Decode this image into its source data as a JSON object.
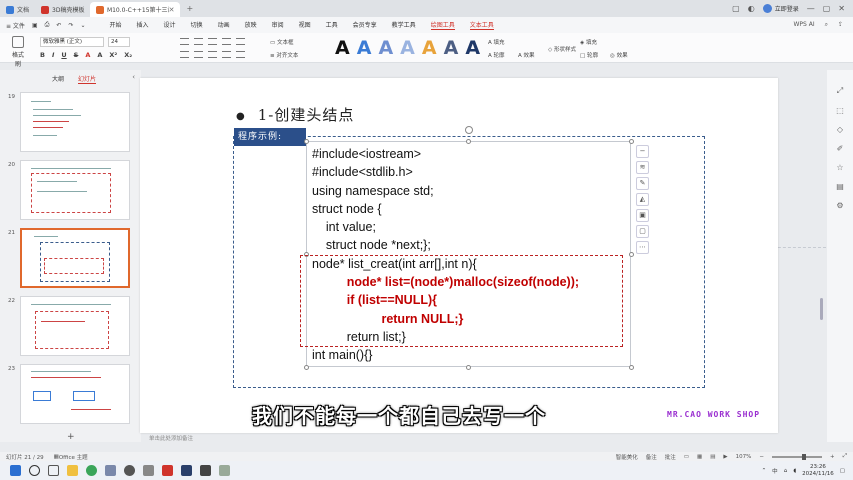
{
  "titlebar": {
    "tabs": [
      {
        "label": "文档",
        "color": "#3a7bd5"
      },
      {
        "label": "3D稿壳模板",
        "color": "#d0342c"
      },
      {
        "label": "M10.0-C++15第十三讲-链表创...",
        "color": "#e0682c",
        "active": true
      }
    ],
    "login_label": "立即登录"
  },
  "menubar": {
    "file_label": "≡ 文件",
    "items": [
      "开始",
      "插入",
      "设计",
      "切换",
      "动画",
      "放映",
      "审阅",
      "视图",
      "工具",
      "会员专享",
      "教学工具",
      "绘图工具",
      "文本工具"
    ],
    "highlight": [
      "绘图工具",
      "文本工具"
    ],
    "right_items": [
      "WPS AI"
    ]
  },
  "ribbon": {
    "paste_label": "格式刷",
    "font_name": "微软雅黑 (正文)",
    "font_size": "24",
    "format_buttons": [
      "B",
      "I",
      "U",
      "S",
      "A",
      "A",
      "X²",
      "X₂"
    ],
    "textbox_label": "文本框",
    "arrange_label": "对齐文本",
    "style_letters": [
      "A",
      "A",
      "A",
      "A",
      "A",
      "A",
      "A"
    ],
    "style_colors": [
      "#111111",
      "#3a7bd5",
      "#6f8fd0",
      "#9ab3e0",
      "#e8a33b",
      "#4d5f84",
      "#1f3868"
    ],
    "fill_label": "填充",
    "outline_label": "轮廓",
    "effect_label": "效果",
    "shape_fill_label": "填充",
    "shape_outline_label": "轮廓",
    "shape_effect_label": "效果",
    "format_label": "形状样式"
  },
  "leftpanel": {
    "tabs": [
      "大纲",
      "幻灯片"
    ],
    "active_tab": "幻灯片",
    "slides": [
      {
        "num": "19"
      },
      {
        "num": "20"
      },
      {
        "num": "21",
        "selected": true
      },
      {
        "num": "22"
      },
      {
        "num": "23"
      }
    ],
    "add_label": "+"
  },
  "slide": {
    "title": "1-创建头结点",
    "example_label": "程序示例:",
    "code_lines": [
      {
        "text": "#include<iostream>",
        "red": false
      },
      {
        "text": "#include<stdlib.h>",
        "red": false
      },
      {
        "text": "using namespace std;",
        "red": false
      },
      {
        "text": "struct node {",
        "red": false
      },
      {
        "text": "    int value;",
        "red": false
      },
      {
        "text": "    struct node *next;};",
        "red": false
      },
      {
        "text": "node* list_creat(int arr[],int n){",
        "red": false
      },
      {
        "text": "          node* list=(node*)malloc(sizeof(node));",
        "red": true
      },
      {
        "text": "          if (list==NULL){",
        "red": true
      },
      {
        "text": "                    return NULL;}",
        "red": true
      },
      {
        "text": "          return list;}",
        "red": false
      },
      {
        "text": "int main(){}",
        "red": false
      }
    ],
    "watermark": "MR.CAO WORK SHOP",
    "subtitle": "我们不能每一个都自己去写一个",
    "notes_placeholder": "单击此处添加备注"
  },
  "statusbar": {
    "slide_count": "幻灯片 21 / 29",
    "theme": "Office 主题",
    "smart": "智能美化",
    "notes": "备注",
    "comment": "批注",
    "zoom": "107%"
  },
  "taskbar": {
    "time": "23:26",
    "date": "2024/11/16"
  }
}
